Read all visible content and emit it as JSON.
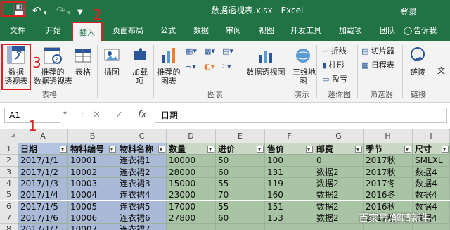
{
  "titlebar": {
    "title": "数据透视表.xlsx - Excel",
    "login": "登录",
    "icons": [
      "save-icon",
      "undo-icon",
      "redo-icon",
      "customize-icon"
    ]
  },
  "annotations": {
    "one": "1",
    "two": "2",
    "three": "3"
  },
  "tabs": [
    "文件",
    "开始",
    "插入",
    "页面布局",
    "公式",
    "数据",
    "审阅",
    "视图",
    "开发工具",
    "加载项",
    "团队",
    "告诉我"
  ],
  "ribbon": {
    "pivot_table": "数据\n透视表",
    "recommended_pivot": "推荐的\n数据透视表",
    "table": "表格",
    "group_tables": "表格",
    "illustrations": "插图",
    "addins": "加载\n项",
    "recommended_charts": "推荐的\n图表",
    "pivot_chart": "数据透视图",
    "map_3d": "三维地\n图",
    "sparkline_line": "折线",
    "sparkline_column": "柱形",
    "sparkline_winloss": "盈亏",
    "slicer": "切片器",
    "timeline": "日程表",
    "link": "链接",
    "text": "文",
    "group_charts": "图表",
    "group_tours": "演示",
    "group_sparklines": "迷你图",
    "group_filters": "筛选器",
    "group_links": "链接"
  },
  "formula_bar": {
    "name_box": "A1",
    "fx": "fx",
    "value": "日期"
  },
  "columns": [
    "A",
    "B",
    "C",
    "D",
    "E",
    "F",
    "G",
    "H",
    "I"
  ],
  "rows": [
    "1",
    "2",
    "3",
    "4",
    "5",
    "6",
    "7",
    "8"
  ],
  "table": {
    "headers": [
      "日期",
      "物料编号",
      "物料名称",
      "数量",
      "进价",
      "售价",
      "邮费",
      "季节",
      "尺寸"
    ],
    "data": [
      [
        "2017/1/1",
        "10001",
        "连衣裙1",
        "10000",
        "50",
        "100",
        "0",
        "2017秋",
        "SMLXL"
      ],
      [
        "2017/1/2",
        "10002",
        "连衣裙2",
        "28000",
        "60",
        "131",
        "数据2",
        "2017秋",
        "数据4"
      ],
      [
        "2017/1/3",
        "10003",
        "连衣裙3",
        "15000",
        "55",
        "119",
        "数据2",
        "2017冬",
        "数据4"
      ],
      [
        "2017/1/4",
        "10004",
        "连衣裙4",
        "23000",
        "70",
        "160",
        "数据2",
        "2016冬",
        "数据4"
      ],
      [
        "2017/1/5",
        "10005",
        "连衣裙5",
        "17000",
        "55",
        "151",
        "数据2",
        "2016秋",
        "数据4"
      ],
      [
        "2017/1/6",
        "10006",
        "连衣裙6",
        "27800",
        "60",
        "153",
        "数据2",
        "2017秋",
        "数据4"
      ],
      [
        "2017/1/7",
        "10007",
        "连衣裙7",
        "",
        "",
        "",
        "",
        "",
        ""
      ]
    ]
  },
  "watermark": "百家号/解晴新生",
  "colors": {
    "accent": "#217346",
    "annotation": "#e02020"
  }
}
